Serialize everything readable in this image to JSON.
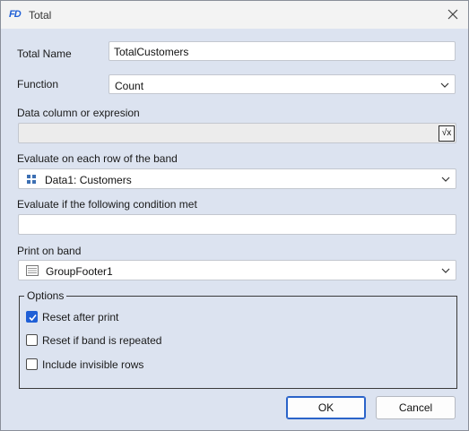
{
  "window": {
    "app_icon_text": "FD",
    "title": "Total"
  },
  "total_name": {
    "label": "Total Name",
    "value": "TotalCustomers"
  },
  "function": {
    "label": "Function",
    "value": "Count"
  },
  "expression": {
    "label": "Data column or expresion",
    "value": "",
    "button_label": "√x"
  },
  "evaluate_band": {
    "label": "Evaluate on each row of the band",
    "value": "Data1: Customers"
  },
  "condition": {
    "label": "Evaluate if the following condition met",
    "value": ""
  },
  "print_band": {
    "label": "Print on band",
    "value": "GroupFooter1"
  },
  "options": {
    "title": "Options",
    "items": [
      {
        "label": "Reset after print",
        "checked": true
      },
      {
        "label": "Reset if band is repeated",
        "checked": false
      },
      {
        "label": "Include invisible rows",
        "checked": false
      }
    ]
  },
  "buttons": {
    "ok": "OK",
    "cancel": "Cancel"
  },
  "colors": {
    "accent": "#1f5fd6",
    "background": "#dce3f0"
  }
}
